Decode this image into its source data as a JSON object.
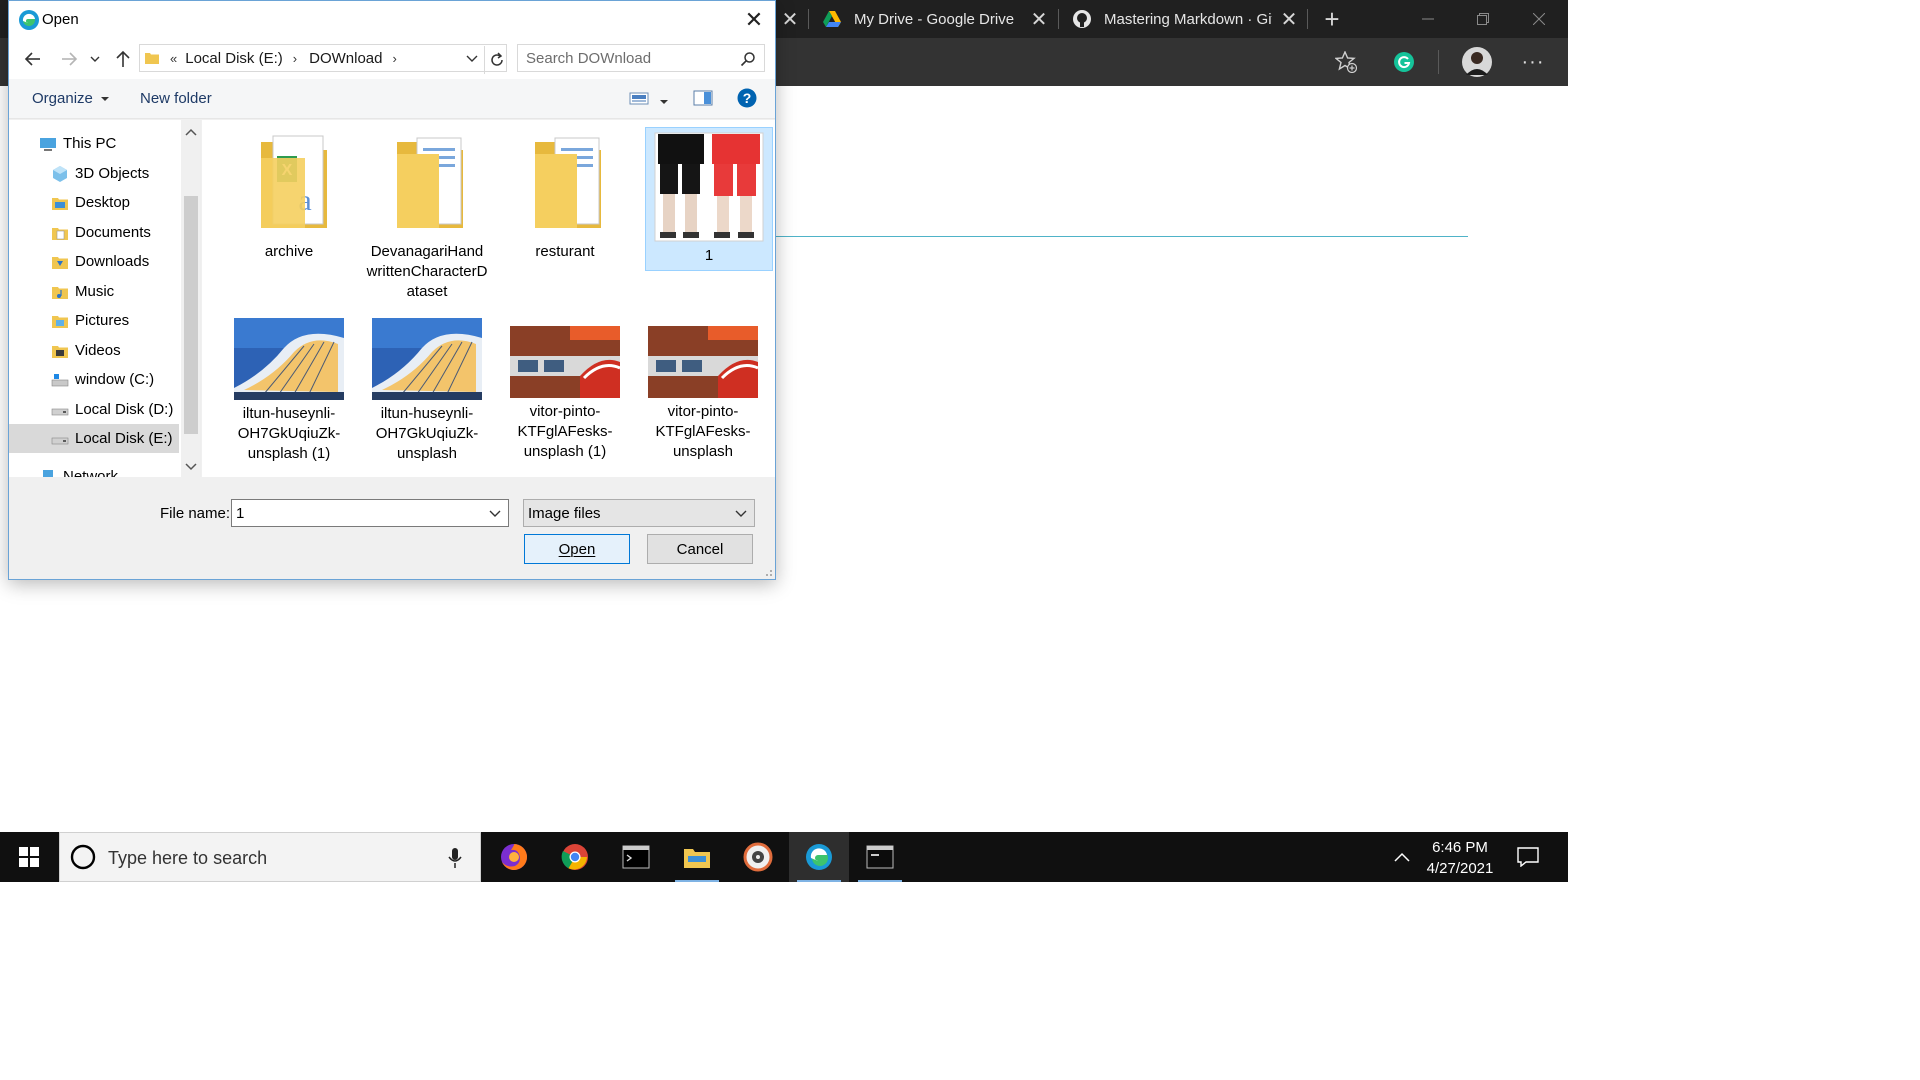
{
  "browser": {
    "tabs": [
      {
        "title": "My Drive - Google Drive",
        "icon": "google-drive-icon"
      },
      {
        "title": "Mastering Markdown · GitHub",
        "icon": "github-icon"
      }
    ],
    "new_tab_symbol": "+",
    "close_symbol": "✕",
    "more_symbol": "···"
  },
  "dialog": {
    "title": "Open",
    "close_symbol": "✕",
    "breadcrumb": {
      "overflow": "«",
      "items": [
        "Local Disk (E:)",
        "DOWnload"
      ],
      "separator": "›"
    },
    "search_placeholder": "Search DOWnload",
    "commands": {
      "organize": "Organize",
      "new_folder": "New folder",
      "help": "?"
    },
    "nav_items": [
      {
        "label": "This PC",
        "icon": "computer-icon"
      },
      {
        "label": "3D Objects",
        "icon": "3d-objects-icon"
      },
      {
        "label": "Desktop",
        "icon": "desktop-folder-icon"
      },
      {
        "label": "Documents",
        "icon": "documents-folder-icon"
      },
      {
        "label": "Downloads",
        "icon": "downloads-folder-icon"
      },
      {
        "label": "Music",
        "icon": "music-folder-icon"
      },
      {
        "label": "Pictures",
        "icon": "pictures-folder-icon"
      },
      {
        "label": "Videos",
        "icon": "videos-folder-icon"
      },
      {
        "label": "window (C:)",
        "icon": "windows-drive-icon"
      },
      {
        "label": "Local Disk (D:)",
        "icon": "drive-icon"
      },
      {
        "label": "Local Disk (E:)",
        "icon": "drive-icon",
        "selected": true
      },
      {
        "label": "Network",
        "icon": "network-icon"
      }
    ],
    "files": [
      {
        "label": "archive",
        "kind": "folder-excel"
      },
      {
        "label": "DevanagariHandwrittenCharacterDataset",
        "kind": "folder"
      },
      {
        "label": "resturant",
        "kind": "folder"
      },
      {
        "label": "1",
        "kind": "image-shorts",
        "selected": true
      },
      {
        "label": "iltun-huseynli-OH7GkUqiuZk-unsplash (1)",
        "kind": "image-building"
      },
      {
        "label": "iltun-huseynli-OH7GkUqiuZk-unsplash",
        "kind": "image-building"
      },
      {
        "label": "vitor-pinto-KTFglAFesks-unsplash (1)",
        "kind": "image-brick"
      },
      {
        "label": "vitor-pinto-KTFglAFesks-unsplash",
        "kind": "image-brick"
      }
    ],
    "file_name_label": "File name:",
    "file_name_value": "1",
    "file_type": "Image files",
    "open_label": "Open",
    "cancel_label": "Cancel"
  },
  "taskbar": {
    "search_placeholder": "Type here to search",
    "apps": [
      "firefox-icon",
      "chrome-icon",
      "terminal-icon",
      "file-explorer-icon",
      "media-player-icon",
      "edge-icon",
      "command-prompt-icon"
    ],
    "time": "6:46 PM",
    "date": "4/27/2021"
  },
  "colors": {
    "accent": "#0078d7",
    "selection": "#cce8ff",
    "taskbar": "#101010",
    "browser_chrome": "#202020"
  }
}
